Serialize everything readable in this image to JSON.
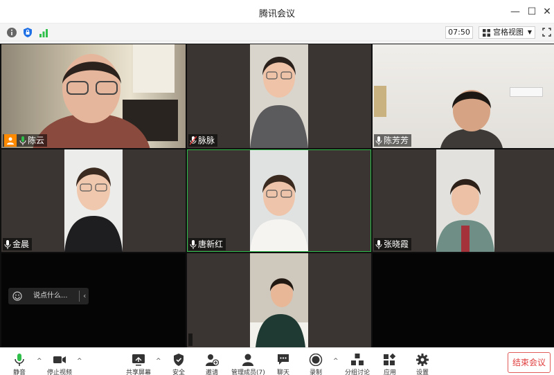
{
  "window": {
    "title": "腾讯会议"
  },
  "infobar": {
    "timer": "07:50",
    "view_label": "宫格视图"
  },
  "participants": [
    {
      "name": "陈云",
      "mic": "on",
      "host": true
    },
    {
      "name": "脉脉",
      "mic": "muted"
    },
    {
      "name": "陈芳芳",
      "mic": "on"
    },
    {
      "name": "金晨",
      "mic": "on"
    },
    {
      "name": "唐新红",
      "mic": "on",
      "speaking": true
    },
    {
      "name": "张晓霞",
      "mic": "on"
    },
    {
      "name": ""
    }
  ],
  "chat": {
    "placeholder": "说点什么..."
  },
  "toolbar": {
    "mute_label": "静音",
    "video_label": "停止视频",
    "share_label": "共享屏幕",
    "security_label": "安全",
    "invite_label": "邀请",
    "members_label": "管理成员(7)",
    "chat_label": "聊天",
    "record_label": "录制",
    "breakout_label": "分组讨论",
    "apps_label": "应用",
    "settings_label": "设置",
    "end_label": "结束会议"
  },
  "colors": {
    "accent_green": "#2fbf4a",
    "end_red": "#e03c3c",
    "avatar_orange": "#ff8a00",
    "shield_blue": "#1f6fe5"
  }
}
